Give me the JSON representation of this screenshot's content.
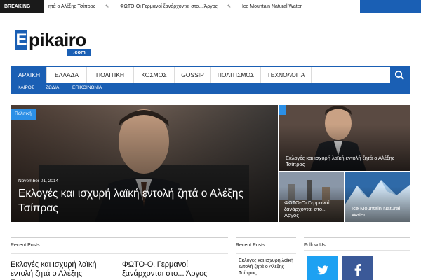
{
  "colors": {
    "brand": "#1a5fb4",
    "accent": "#2b8fe6",
    "breaking_bg": "#1a1a1a",
    "twitter": "#1da1f2",
    "facebook": "#3b5998"
  },
  "breaking": {
    "label": "BREAKING NEWS",
    "items": [
      "ητά ο Αλέξης Τσίπρας",
      "ΦΩΤΟ-Οι Γερμανοί ξανάρχονται στο... Άργος",
      "Ice Mountain Natural Water"
    ],
    "item_icon": "pin-icon"
  },
  "logo": {
    "initial": "E",
    "rest": "pikairo",
    "suffix": ".com"
  },
  "nav": {
    "items": [
      "ΑΡΧΙΚΗ",
      "ΕΛΛΑΔΑ",
      "ΠΟΛΙΤΙΚΗ",
      "ΚΟΣΜΟΣ",
      "GOSSIP",
      "ΠΟΛΙΤΙΣΜΟΣ",
      "ΤΕΧΝΟΛΟΓΙΑ"
    ],
    "active": "ΑΡΧΙΚΗ",
    "search_icon": "search-icon",
    "sub_items": [
      "ΚΑΙΡΟΣ",
      "ΖΩΔΙΑ",
      "ΕΠΙΚΟΙΝΩΝΙΑ"
    ]
  },
  "hero": {
    "main": {
      "category": "Πολιτική",
      "date": "November 01, 2014",
      "title": "Εκλογές και ισχυρή λαϊκή εντολή ζητά ο Αλέξης Τσίπρας"
    },
    "side_top": {
      "title": "Εκλογές και ισχυρή λαϊκή εντολή ζητά ο Αλέξης Τσίπρας"
    },
    "side_bottom_left": {
      "title": "ΦΩΤΟ-Οι Γερμανοί ξανάρχονται στο... Άργος"
    },
    "side_bottom_right": {
      "title": "Ice Mountain Natural Water"
    }
  },
  "widgets": {
    "recent_left": {
      "heading": "Recent Posts",
      "posts": [
        "Εκλογές και ισχυρή λαϊκή εντολή ζητά ο Αλέξης Τσίπρας",
        "ΦΩΤΟ-Οι Γερμανοί ξανάρχονται στο... Άργος"
      ]
    },
    "recent_mid": {
      "heading": "Recent Posts",
      "posts": [
        "Εκλογές και ισχυρή λαϊκή εντολή ζητά ο Αλέξης Τσίπρας"
      ]
    },
    "follow": {
      "heading": "Follow Us",
      "networks": [
        "twitter-icon",
        "facebook-icon"
      ]
    }
  }
}
